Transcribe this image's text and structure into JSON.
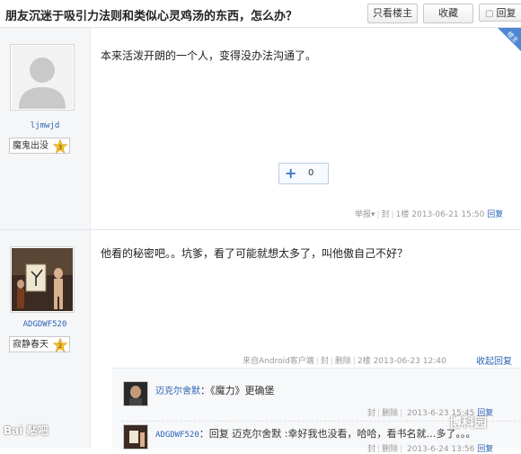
{
  "header": {
    "title": "朋友沉迷于吸引力法则和类似心灵鸡汤的东西，怎么办？",
    "only_op_label": "只看楼主",
    "favorite_label": "收藏",
    "reply_label": "回复"
  },
  "post1": {
    "op_ribbon": "楼主",
    "username": "ljmwjd",
    "badge_label": "魔鬼出没",
    "badge_level": "3",
    "content": "本来活泼开朗的一个人，变得没办法沟通了。",
    "like_count": "0",
    "tail": {
      "report": "举报",
      "block": "封",
      "floor": "1楼",
      "date": "2013-06-21 15:50",
      "reply": "回复"
    }
  },
  "post2": {
    "username": "ADGDWF520",
    "badge_label": "寂静春天",
    "badge_level": "2",
    "content": "他看的秘密吧。。坑爹，看了可能就想太多了，叫他傲自己不好？",
    "tail": {
      "source": "来自Android客户端",
      "block": "封",
      "delete": "删除",
      "floor": "2楼",
      "date": "2013-06-23 12:40",
      "collapse": "收起回复"
    },
    "replies": [
      {
        "name": "迈克尔舍默",
        "text": "：《魔力》更确堡",
        "block": "封",
        "delete": "删除",
        "date": "2013-6-23 15:45",
        "reply": "回复"
      },
      {
        "name": "ADGDWF520",
        "text": "：回复 迈克尔舍默 :幸好我也没看，哈哈，看书名就…多了。。。",
        "block": "封",
        "delete": "删除",
        "date": "2013-6-24 13:56",
        "reply": "回复"
      }
    ]
  },
  "watermarks": {
    "baidu": "Bai 贴吧",
    "site": "博科园"
  },
  "colors": {
    "link": "#2d64b3",
    "sidebar": "#f4f6f8",
    "ribbon": "#4e86d4"
  }
}
